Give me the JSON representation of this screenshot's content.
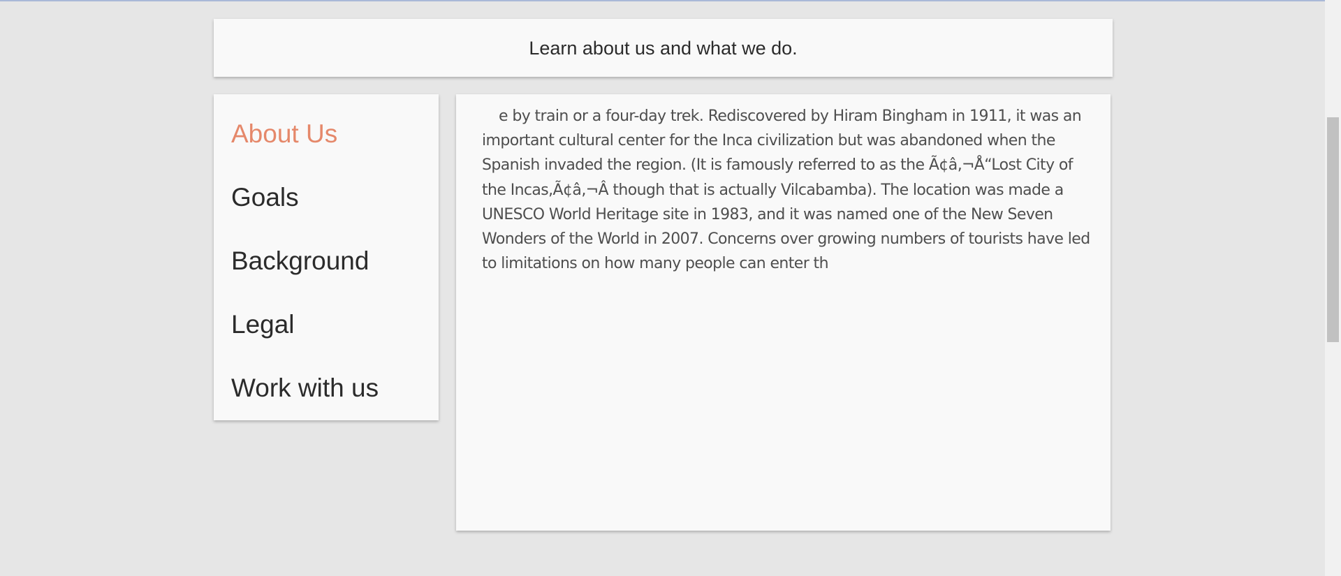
{
  "header": {
    "title": "Learn about us and what we do."
  },
  "sidebar": {
    "items": [
      {
        "label": "About Us",
        "active": true
      },
      {
        "label": "Goals",
        "active": false
      },
      {
        "label": "Background",
        "active": false
      },
      {
        "label": "Legal",
        "active": false
      },
      {
        "label": "Work with us",
        "active": false
      }
    ]
  },
  "content": {
    "text": "e by train or a four-day trek. Rediscovered by Hiram Bingham in 1911, it was an important cultural center for the Inca civilization but was abandoned when the Spanish invaded the region. (It is famously referred to as the Ã¢â‚¬Å“Lost City of the Incas,Ã¢â‚¬Â though that is actually Vilcabamba). The location was made a UNESCO World Heritage site in 1983, and it was named one of the New Seven Wonders of the World in 2007. Concerns over growing numbers of tourists have led to limitations on how many people can enter th"
  },
  "colors": {
    "background": "#e6e6e6",
    "card": "#f9f9f9",
    "accent_active": "#e5886a",
    "text_dark": "#2b2b2b",
    "text_body": "#4e4e4e"
  }
}
